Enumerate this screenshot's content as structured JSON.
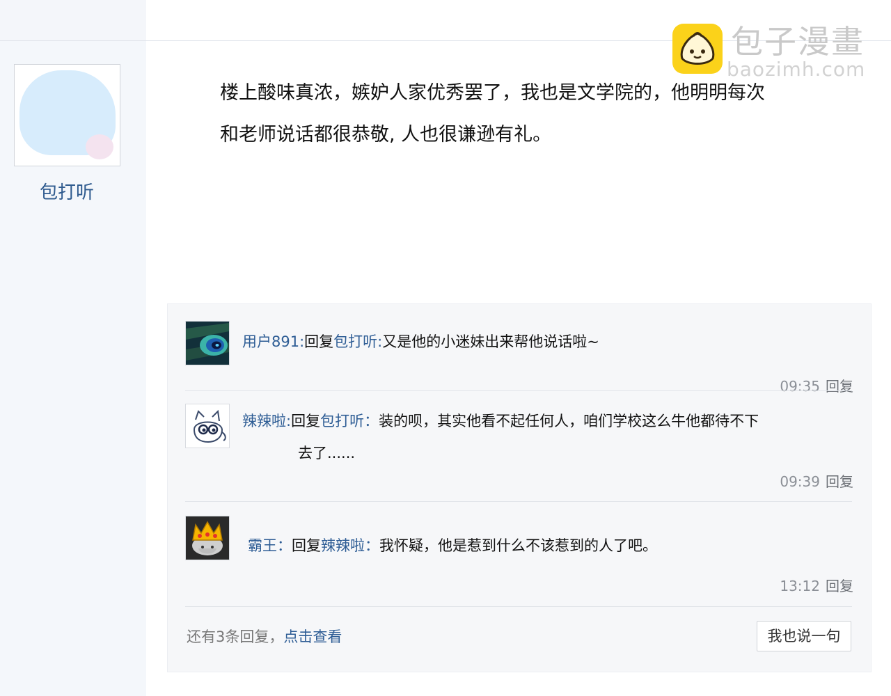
{
  "post": {
    "author": "包打听",
    "body_line1": "楼上酸味真浓，嫉妒人家优秀罢了，我也是文学院的，他明明每次",
    "body_line2": "和老师说话都很恭敬, 人也很谦逊有礼。"
  },
  "watermark": {
    "cn": "包子漫畫",
    "en": "baozimh.com"
  },
  "replies": [
    {
      "user": "用户891",
      "sep": ":",
      "reply_word": "回复",
      "target": "包打听",
      "target_sep": ":",
      "text_line1": "又是他的小迷妹出来帮他说话啦~",
      "text_line2": "",
      "time": "09:35",
      "action": "回复",
      "avatar_icon": "peacock-feather-icon"
    },
    {
      "user": "辣辣啦",
      "sep": ":",
      "reply_word": "回复",
      "target": "包打听",
      "target_sep": "：",
      "text_line1": "装的呗，其实他看不起任何人，咱们学校这么牛他都待不下",
      "text_line2": "去了......",
      "time": "09:39",
      "action": "回复",
      "avatar_icon": "cartoon-cat-icon"
    },
    {
      "user": "霸王",
      "sep": "：",
      "reply_word": "回复",
      "target": "辣辣啦",
      "target_sep": "：",
      "text_line1": "我怀疑，他是惹到什么不该惹到的人了吧。",
      "text_line2": "",
      "time": "13:12",
      "action": "回复",
      "avatar_icon": "crown-mushroom-icon"
    }
  ],
  "footer": {
    "more_prefix": "还有3条回复，",
    "more_link": "点击查看",
    "say_button": "我也说一句"
  },
  "colors": {
    "username": "#2e5d95",
    "reply_box_bg": "#f6f7f9",
    "sidebar_bg": "#f4f7fb",
    "watermark_icon": "#fbd21a"
  }
}
